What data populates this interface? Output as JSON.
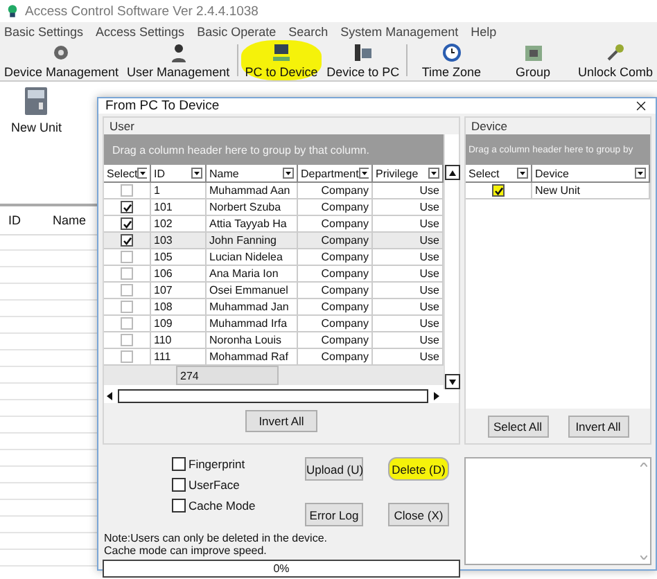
{
  "window": {
    "title": "Access Control Software  Ver 2.4.4.1038"
  },
  "menu": [
    "Basic Settings",
    "Access Settings",
    "Basic Operate",
    "Search",
    "System Management",
    "Help"
  ],
  "toolbar": [
    {
      "label": "Device Management",
      "highlighted": false,
      "separator_after": false
    },
    {
      "label": "User Management",
      "highlighted": false,
      "separator_after": true
    },
    {
      "label": "PC to Device",
      "highlighted": true,
      "separator_after": false
    },
    {
      "label": "Device to PC",
      "highlighted": false,
      "separator_after": true
    },
    {
      "label": "Time Zone",
      "highlighted": false,
      "separator_after": false
    },
    {
      "label": "Group",
      "highlighted": false,
      "separator_after": false
    },
    {
      "label": "Unlock Comb",
      "highlighted": false,
      "separator_after": false
    }
  ],
  "device_panel": {
    "items": [
      {
        "label": "New Unit"
      }
    ]
  },
  "main_table": {
    "columns": [
      "ID",
      "Name"
    ]
  },
  "dialog": {
    "title": "From PC To Device",
    "user_group": {
      "title": "User",
      "group_hint": "Drag a column header here to group by that column.",
      "columns": [
        "Select",
        "ID",
        "Name",
        "Department",
        "Privilege"
      ],
      "rows": [
        {
          "id": "1",
          "name": "Muhammad Aan",
          "department": "Company",
          "privilege": "Use",
          "checked": false,
          "selected": false
        },
        {
          "id": "101",
          "name": "Norbert Szuba",
          "department": "Company",
          "privilege": "Use",
          "checked": true,
          "selected": false
        },
        {
          "id": "102",
          "name": "Attia Tayyab Ha",
          "department": "Company",
          "privilege": "Use",
          "checked": true,
          "selected": false
        },
        {
          "id": "103",
          "name": "John Fanning",
          "department": "Company",
          "privilege": "Use",
          "checked": true,
          "selected": true
        },
        {
          "id": "105",
          "name": "Lucian Nidelea",
          "department": "Company",
          "privilege": "Use",
          "checked": false,
          "selected": false
        },
        {
          "id": "106",
          "name": "Ana Maria Ion",
          "department": "Company",
          "privilege": "Use",
          "checked": false,
          "selected": false
        },
        {
          "id": "107",
          "name": "Osei Emmanuel",
          "department": "Company",
          "privilege": "Use",
          "checked": false,
          "selected": false
        },
        {
          "id": "108",
          "name": "Muhammad Jan",
          "department": "Company",
          "privilege": "Use",
          "checked": false,
          "selected": false
        },
        {
          "id": "109",
          "name": "Muhammad Irfa",
          "department": "Company",
          "privilege": "Use",
          "checked": false,
          "selected": false
        },
        {
          "id": "110",
          "name": "Noronha Louis",
          "department": "Company",
          "privilege": "Use",
          "checked": false,
          "selected": false
        },
        {
          "id": "111",
          "name": "Mohammad Raf",
          "department": "Company",
          "privilege": "Use",
          "checked": false,
          "selected": false
        }
      ],
      "footer_count": "274",
      "invert_button": "Invert All"
    },
    "device_group": {
      "title": "Device",
      "group_hint": "Drag a column header here to group by",
      "columns": [
        "Select",
        "Device"
      ],
      "rows": [
        {
          "device": "New Unit",
          "checked": true,
          "highlighted": true
        }
      ],
      "buttons": [
        "Select All",
        "Invert All"
      ]
    },
    "options": [
      {
        "label": "Fingerprint",
        "checked": false
      },
      {
        "label": "UserFace",
        "checked": false
      },
      {
        "label": "Cache Mode",
        "checked": false
      }
    ],
    "buttons": [
      {
        "label": "Upload (U)",
        "highlighted": false
      },
      {
        "label": "Delete (D)",
        "highlighted": true
      },
      {
        "label": "Error Log",
        "highlighted": false
      },
      {
        "label": "Close (X)",
        "highlighted": false
      }
    ],
    "note": "Note:Users can only be deleted in the device.\nCache mode can improve speed.",
    "progress": {
      "level": 0,
      "reading": "0%"
    }
  }
}
